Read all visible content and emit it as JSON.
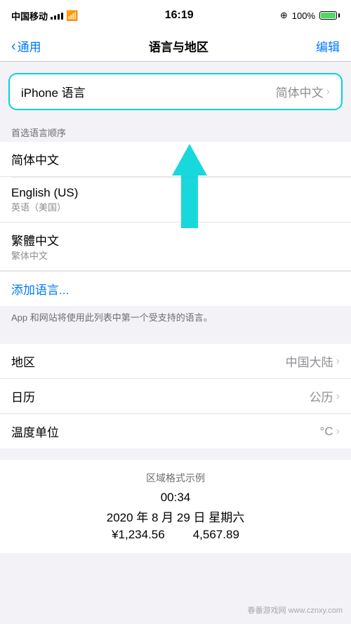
{
  "statusBar": {
    "carrier": "中国移动",
    "time": "16:19",
    "battery": "100%",
    "batteryIcon": "🔋"
  },
  "navBar": {
    "backLabel": "通用",
    "title": "语言与地区",
    "actionLabel": "编辑"
  },
  "iPhoneLang": {
    "label": "iPhone 语言",
    "value": "简体中文"
  },
  "preferredOrder": {
    "sectionLabel": "首选语言顺序",
    "items": [
      {
        "primary": "简体中文",
        "secondary": ""
      },
      {
        "primary": "English (US)",
        "secondary": "英语（美国）"
      },
      {
        "primary": "繁體中文",
        "secondary": "繁体中文"
      }
    ],
    "addLanguage": "添加语言...",
    "infoText": "App 和网站将使用此列表中第一个受支持的语言。"
  },
  "region": {
    "label": "地区",
    "value": "中国大陆"
  },
  "calendar": {
    "label": "日历",
    "value": "公历"
  },
  "temperature": {
    "label": "温度单位",
    "value": "°C"
  },
  "formatExample": {
    "title": "区域格式示例",
    "time": "00:34",
    "date": "2020 年 8 月 29 日 星期六",
    "number1": "¥1,234.56",
    "number2": "4,567.89"
  },
  "watermark": "春番游戏网 www.cznxy.com"
}
